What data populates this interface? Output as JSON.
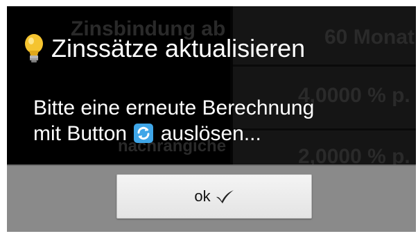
{
  "dialog": {
    "title": "Zinssätze aktualisieren",
    "message_line1": "Bitte eine erneute Berechnung",
    "message_line2_prefix": "mit Button",
    "message_line2_suffix": "auslösen...",
    "icons": {
      "title_icon": "lightbulb-icon",
      "inline_icon": "refresh-icon",
      "button_icon": "checkmark-icon"
    },
    "colors": {
      "dialog_background": "#050505",
      "button_bar": "#8a8a8a",
      "refresh_icon": "#3fa6e8",
      "bulb": "#f5c430"
    }
  },
  "buttons": {
    "ok_label": "ok"
  },
  "background_table": {
    "row1_left": "Zinsbindung ab",
    "row1_right": "60 Monat",
    "row2_right": "4,0000 % p.",
    "row3_left": "nachrangiche",
    "row3_right": "2,0000 % p."
  }
}
